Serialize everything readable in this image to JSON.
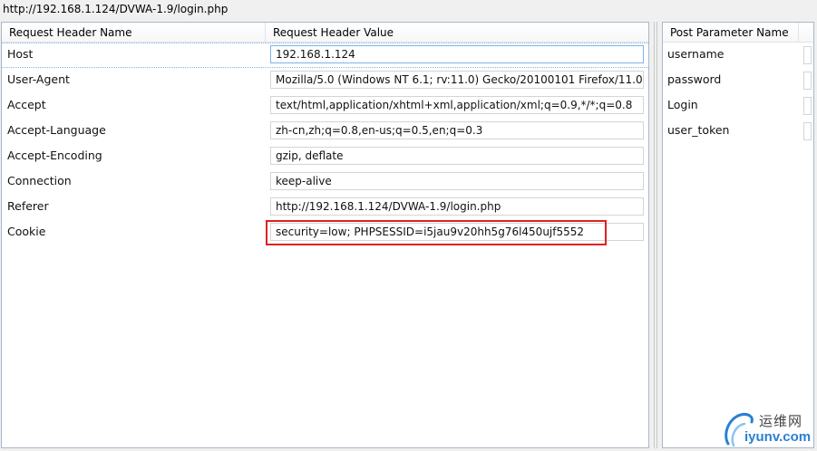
{
  "url": "http://192.168.1.124/DVWA-1.9/login.php",
  "request_headers": {
    "col_name": "Request Header Name",
    "col_value": "Request Header Value",
    "rows": [
      {
        "name": "Host",
        "value": "192.168.1.124"
      },
      {
        "name": "User-Agent",
        "value": "Mozilla/5.0 (Windows NT 6.1; rv:11.0) Gecko/20100101 Firefox/11.0"
      },
      {
        "name": "Accept",
        "value": "text/html,application/xhtml+xml,application/xml;q=0.9,*/*;q=0.8"
      },
      {
        "name": "Accept-Language",
        "value": "zh-cn,zh;q=0.8,en-us;q=0.5,en;q=0.3"
      },
      {
        "name": "Accept-Encoding",
        "value": "gzip, deflate"
      },
      {
        "name": "Connection",
        "value": "keep-alive"
      },
      {
        "name": "Referer",
        "value": "http://192.168.1.124/DVWA-1.9/login.php"
      },
      {
        "name": "Cookie",
        "value": "security=low; PHPSESSID=i5jau9v20hh5g76l450ujf5552"
      }
    ]
  },
  "post_params": {
    "col_name": "Post Parameter Name",
    "rows": [
      {
        "name": "username"
      },
      {
        "name": "password"
      },
      {
        "name": "Login"
      },
      {
        "name": "user_token"
      }
    ]
  },
  "watermark": {
    "cn": "运维网",
    "en": "iyunv.com"
  },
  "colors": {
    "highlight": "#e02020",
    "selection": "#7eb4ea"
  }
}
